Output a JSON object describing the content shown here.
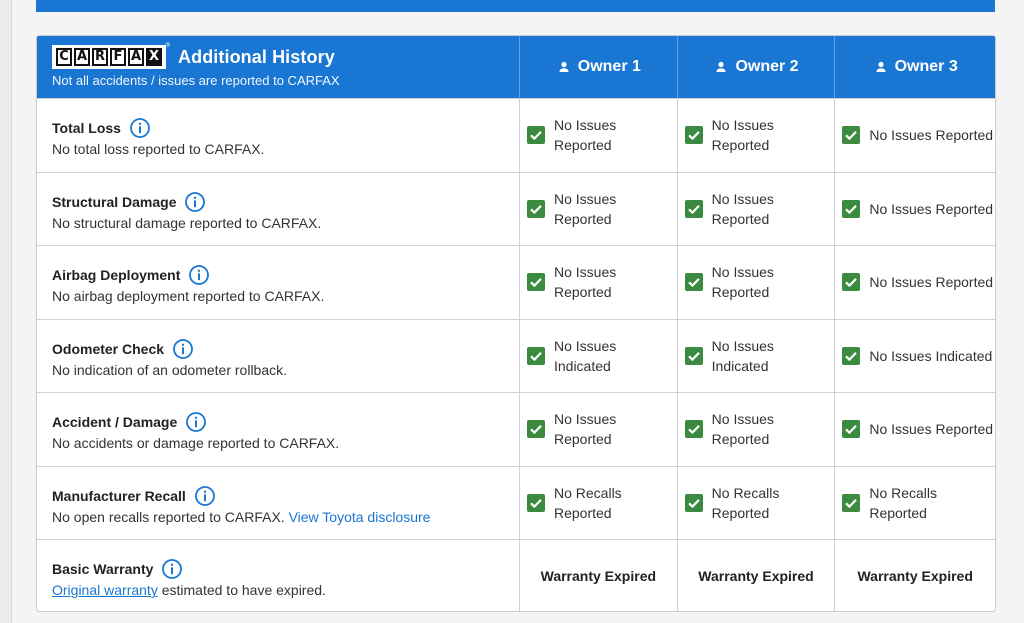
{
  "header": {
    "logo_letters": [
      "C",
      "A",
      "R",
      "F",
      "A",
      "X"
    ],
    "title": "Additional History",
    "subtitle": "Not all accidents / issues are reported to CARFAX",
    "owners": [
      "Owner 1",
      "Owner 2",
      "Owner 3"
    ]
  },
  "colors": {
    "brand_blue": "#1976d2",
    "check_green": "#3a8a3f"
  },
  "rows": [
    {
      "title": "Total Loss",
      "description": "No total loss reported to CARFAX.",
      "statuses": [
        "No Issues Reported",
        "No Issues Reported",
        "No Issues Reported"
      ]
    },
    {
      "title": "Structural Damage",
      "description": "No structural damage reported to CARFAX.",
      "statuses": [
        "No Issues Reported",
        "No Issues Reported",
        "No Issues Reported"
      ]
    },
    {
      "title": "Airbag Deployment",
      "description": "No airbag deployment reported to CARFAX.",
      "statuses": [
        "No Issues Reported",
        "No Issues Reported",
        "No Issues Reported"
      ]
    },
    {
      "title": "Odometer Check",
      "description": "No indication of an odometer rollback.",
      "statuses": [
        "No Issues Indicated",
        "No Issues Indicated",
        "No Issues Indicated"
      ]
    },
    {
      "title": "Accident / Damage",
      "description": "No accidents or damage reported to CARFAX.",
      "statuses": [
        "No Issues Reported",
        "No Issues Reported",
        "No Issues Reported"
      ]
    },
    {
      "title": "Manufacturer Recall",
      "description": "No open recalls reported to CARFAX.",
      "link_text": "View Toyota disclosure",
      "statuses": [
        "No Recalls Reported",
        "No Recalls Reported",
        "No Recalls Reported"
      ]
    },
    {
      "title": "Basic Warranty",
      "link_text": "Original warranty",
      "description": "estimated to have expired.",
      "statuses": [
        "Warranty Expired",
        "Warranty Expired",
        "Warranty Expired"
      ]
    }
  ]
}
